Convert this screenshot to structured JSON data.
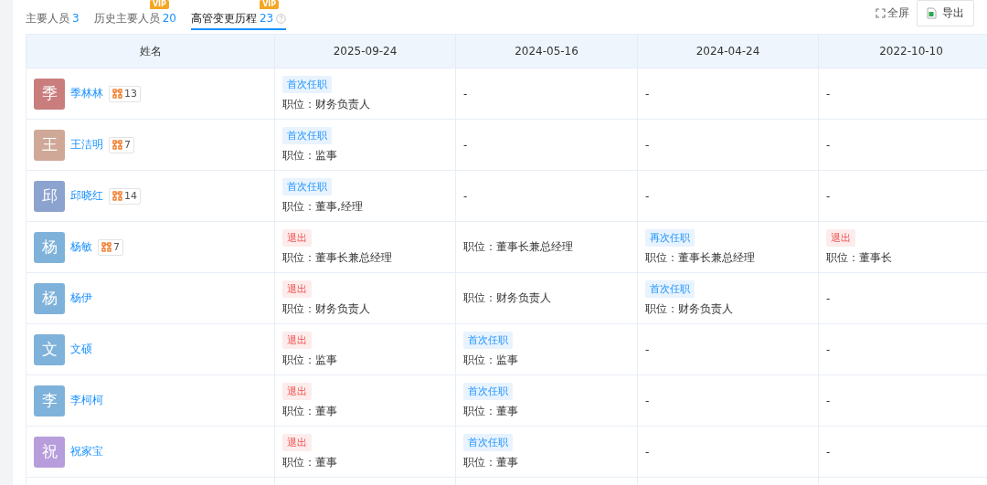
{
  "tabs": [
    {
      "label": "主要人员",
      "count": "3",
      "selected": false
    },
    {
      "label": "历史主要人员",
      "count": "20",
      "selected": false,
      "vip": "VIP"
    },
    {
      "label": "高管变更历程",
      "count": "23",
      "selected": true,
      "vip": "VIP",
      "help": true
    }
  ],
  "actions": [
    {
      "kind": "fullscreen",
      "label": "全屏"
    },
    {
      "kind": "export",
      "label": "导出"
    }
  ],
  "table": {
    "columns": [
      "姓名",
      "2025-09-24",
      "2024-05-16",
      "2024-04-24",
      "2022-10-10"
    ],
    "rows": [
      {
        "cells": [
          {
            "kind": "person",
            "avatar": "季",
            "color": "#c97d7d",
            "name": "季林林",
            "relations": "13"
          },
          {
            "kind": "change",
            "tag": {
              "text": "首次任职",
              "color": "#e8f3fe"
            },
            "position": "职位：财务负责人"
          },
          {
            "kind": "dash",
            "text": "-"
          },
          {
            "kind": "dash",
            "text": "-"
          },
          {
            "kind": "dash",
            "text": "-"
          }
        ]
      },
      {
        "cells": [
          {
            "kind": "person",
            "avatar": "王",
            "color": "#cfa898",
            "name": "王洁明",
            "relations": "7"
          },
          {
            "kind": "change",
            "tag": {
              "text": "首次任职",
              "color": "#e8f3fe"
            },
            "position": "职位：监事"
          },
          {
            "kind": "dash",
            "text": "-"
          },
          {
            "kind": "dash",
            "text": "-"
          },
          {
            "kind": "dash",
            "text": "-"
          }
        ]
      },
      {
        "cells": [
          {
            "kind": "person",
            "avatar": "邱",
            "color": "#8ca3cf",
            "name": "邱晓红",
            "relations": "14"
          },
          {
            "kind": "change",
            "tag": {
              "text": "首次任职",
              "color": "#e8f3fe"
            },
            "position": "职位：董事,经理"
          },
          {
            "kind": "dash",
            "text": "-"
          },
          {
            "kind": "dash",
            "text": "-"
          },
          {
            "kind": "dash",
            "text": "-"
          }
        ]
      },
      {
        "cells": [
          {
            "kind": "person",
            "avatar": "杨",
            "color": "#7fb2da",
            "name": "杨敏",
            "relations": "7"
          },
          {
            "kind": "change",
            "tag": {
              "text": "退出",
              "color": "#fdecec"
            },
            "position": "职位：董事长兼总经理"
          },
          {
            "kind": "plain",
            "position": "职位：董事长兼总经理"
          },
          {
            "kind": "change",
            "tag": {
              "text": "再次任职",
              "color": "#e8f3fe"
            },
            "position": "职位：董事长兼总经理"
          },
          {
            "kind": "change",
            "tag": {
              "text": "退出",
              "color": "#fdecec"
            },
            "position": "职位：董事长"
          }
        ]
      },
      {
        "cells": [
          {
            "kind": "person",
            "avatar": "杨",
            "color": "#7fb2da",
            "name": "杨伊"
          },
          {
            "kind": "change",
            "tag": {
              "text": "退出",
              "color": "#fdecec"
            },
            "position": "职位：财务负责人"
          },
          {
            "kind": "plain",
            "position": "职位：财务负责人"
          },
          {
            "kind": "change",
            "tag": {
              "text": "首次任职",
              "color": "#e8f3fe"
            },
            "position": "职位：财务负责人"
          },
          {
            "kind": "dash",
            "text": "-"
          }
        ]
      },
      {
        "cells": [
          {
            "kind": "person",
            "avatar": "文",
            "color": "#7fb2da",
            "name": "文硕"
          },
          {
            "kind": "change",
            "tag": {
              "text": "退出",
              "color": "#fdecec"
            },
            "position": "职位：监事"
          },
          {
            "kind": "change",
            "tag": {
              "text": "首次任职",
              "color": "#e8f3fe"
            },
            "position": "职位：监事"
          },
          {
            "kind": "dash",
            "text": "-"
          },
          {
            "kind": "dash",
            "text": "-"
          }
        ]
      },
      {
        "cells": [
          {
            "kind": "person",
            "avatar": "李",
            "color": "#7fb2da",
            "name": "李柯柯"
          },
          {
            "kind": "change",
            "tag": {
              "text": "退出",
              "color": "#fdecec"
            },
            "position": "职位：董事"
          },
          {
            "kind": "change",
            "tag": {
              "text": "首次任职",
              "color": "#e8f3fe"
            },
            "position": "职位：董事"
          },
          {
            "kind": "dash",
            "text": "-"
          },
          {
            "kind": "dash",
            "text": "-"
          }
        ]
      },
      {
        "cells": [
          {
            "kind": "person",
            "avatar": "祝",
            "color": "#b79ddb",
            "name": "祝家宝"
          },
          {
            "kind": "change",
            "tag": {
              "text": "退出",
              "color": "#fdecec"
            },
            "position": "职位：董事"
          },
          {
            "kind": "change",
            "tag": {
              "text": "首次任职",
              "color": "#e8f3fe"
            },
            "position": "职位：董事"
          },
          {
            "kind": "dash",
            "text": "-"
          },
          {
            "kind": "dash",
            "text": "-"
          }
        ]
      }
    ]
  }
}
